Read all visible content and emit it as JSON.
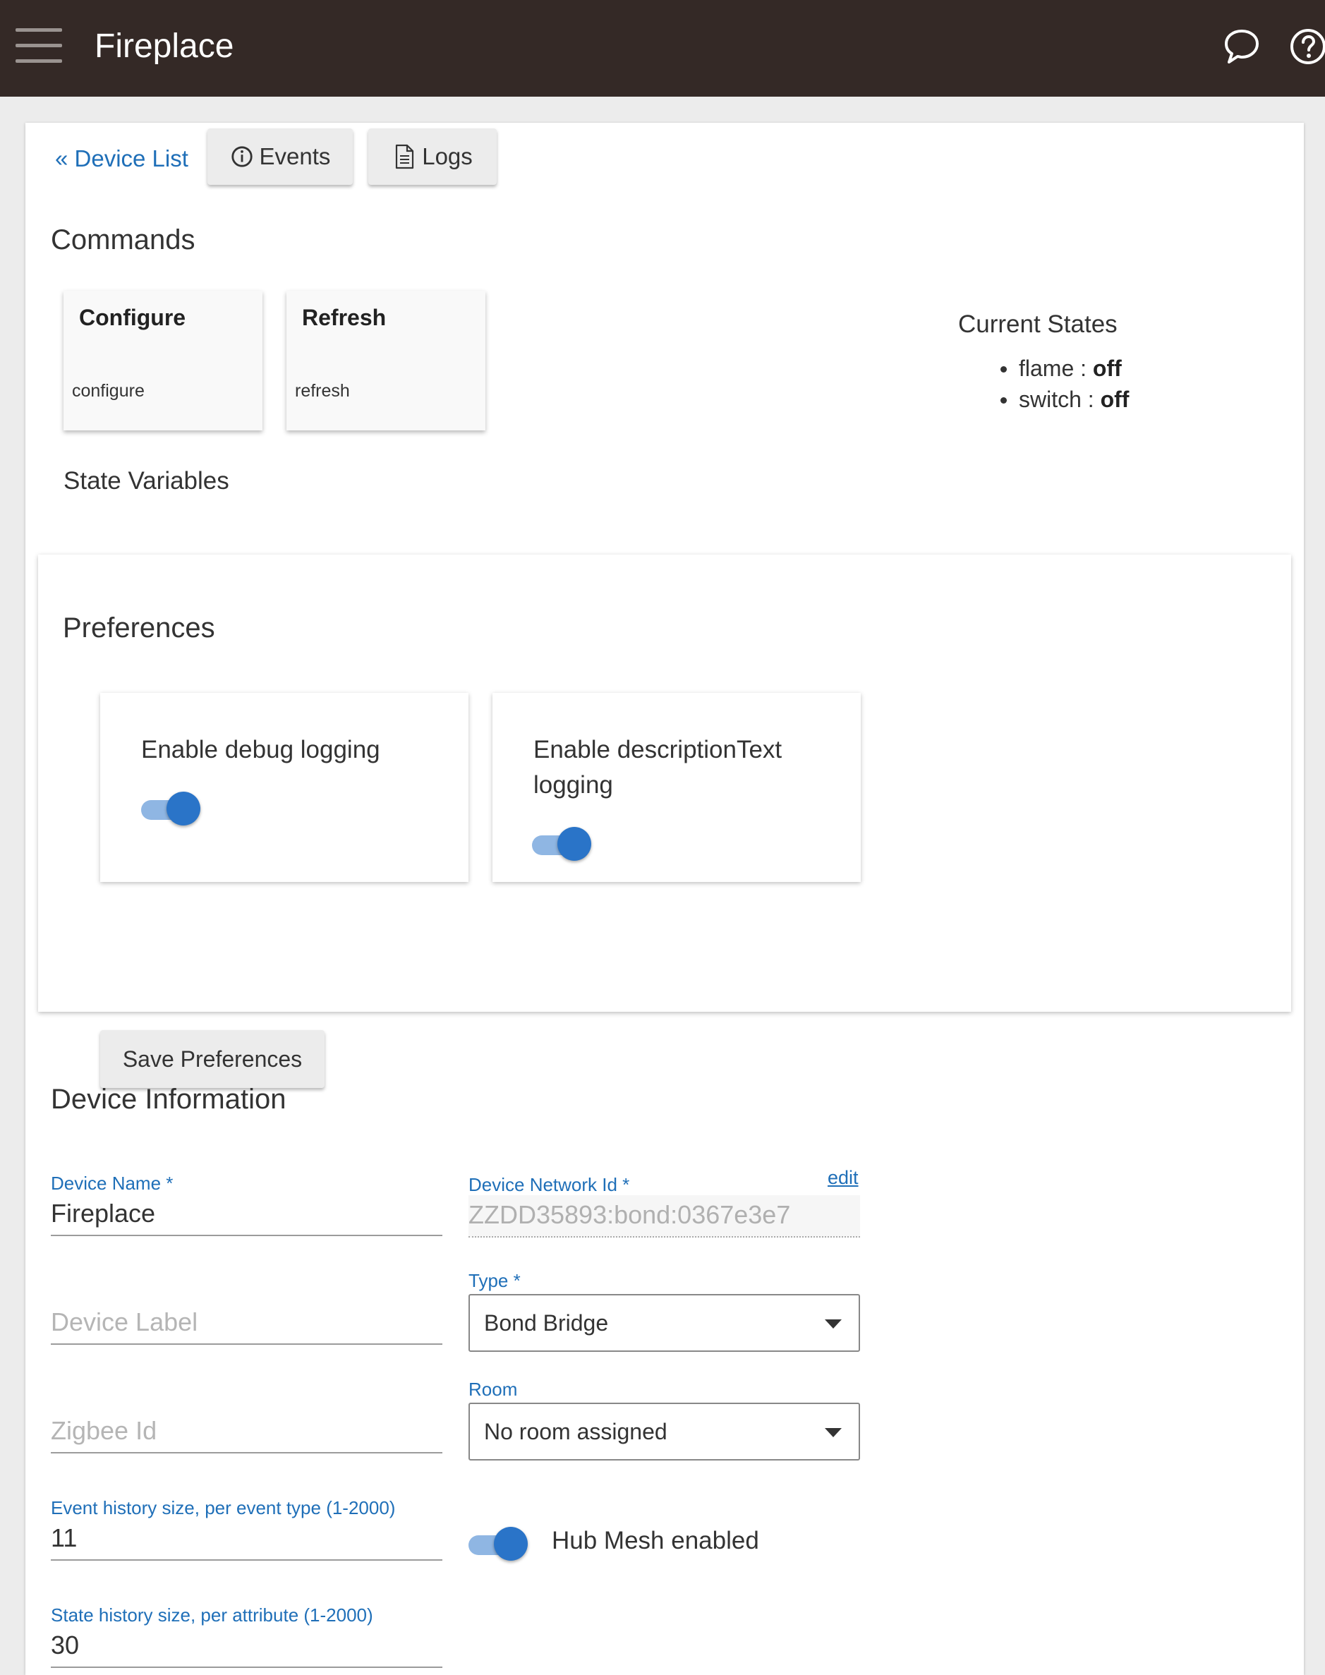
{
  "header": {
    "title": "Fireplace",
    "menu_icon": "hamburger-menu-icon",
    "chat_icon": "chat-bubble-icon",
    "help_icon": "help-circle-icon",
    "bg_color": "#342926"
  },
  "nav": {
    "back_label": "« Device List",
    "events_label": "Events",
    "logs_label": "Logs"
  },
  "commands": {
    "title": "Commands",
    "items": [
      {
        "title": "Configure",
        "sub": "configure"
      },
      {
        "title": "Refresh",
        "sub": "refresh"
      }
    ]
  },
  "current_states": {
    "title": "Current States",
    "items": [
      {
        "name": "flame :",
        "value": "off"
      },
      {
        "name": "switch :",
        "value": "off"
      }
    ]
  },
  "state_variables": {
    "title": "State Variables"
  },
  "preferences": {
    "title": "Preferences",
    "items": [
      {
        "label": "Enable debug logging",
        "enabled": true
      },
      {
        "label": "Enable descriptionText logging",
        "enabled": true
      }
    ],
    "save_label": "Save Preferences"
  },
  "device_info": {
    "title": "Device Information",
    "device_name_label": "Device Name *",
    "device_name_value": "Fireplace",
    "network_id_label": "Device Network Id *",
    "network_id_value": "ZZDD35893:bond:0367e3e7",
    "edit_label": "edit",
    "device_label_placeholder": "Device Label",
    "type_label": "Type *",
    "type_value": "Bond Bridge",
    "zigbee_placeholder": "Zigbee Id",
    "room_label": "Room",
    "room_value": "No room assigned",
    "event_history_label": "Event history size, per event type (1-2000)",
    "event_history_value": "11",
    "hub_mesh_label": "Hub Mesh enabled",
    "hub_mesh_enabled": true,
    "state_history_label": "State history size, per attribute (1-2000)",
    "state_history_value": "30"
  },
  "colors": {
    "accent": "#2a74c8",
    "link": "#1f6fb8"
  }
}
